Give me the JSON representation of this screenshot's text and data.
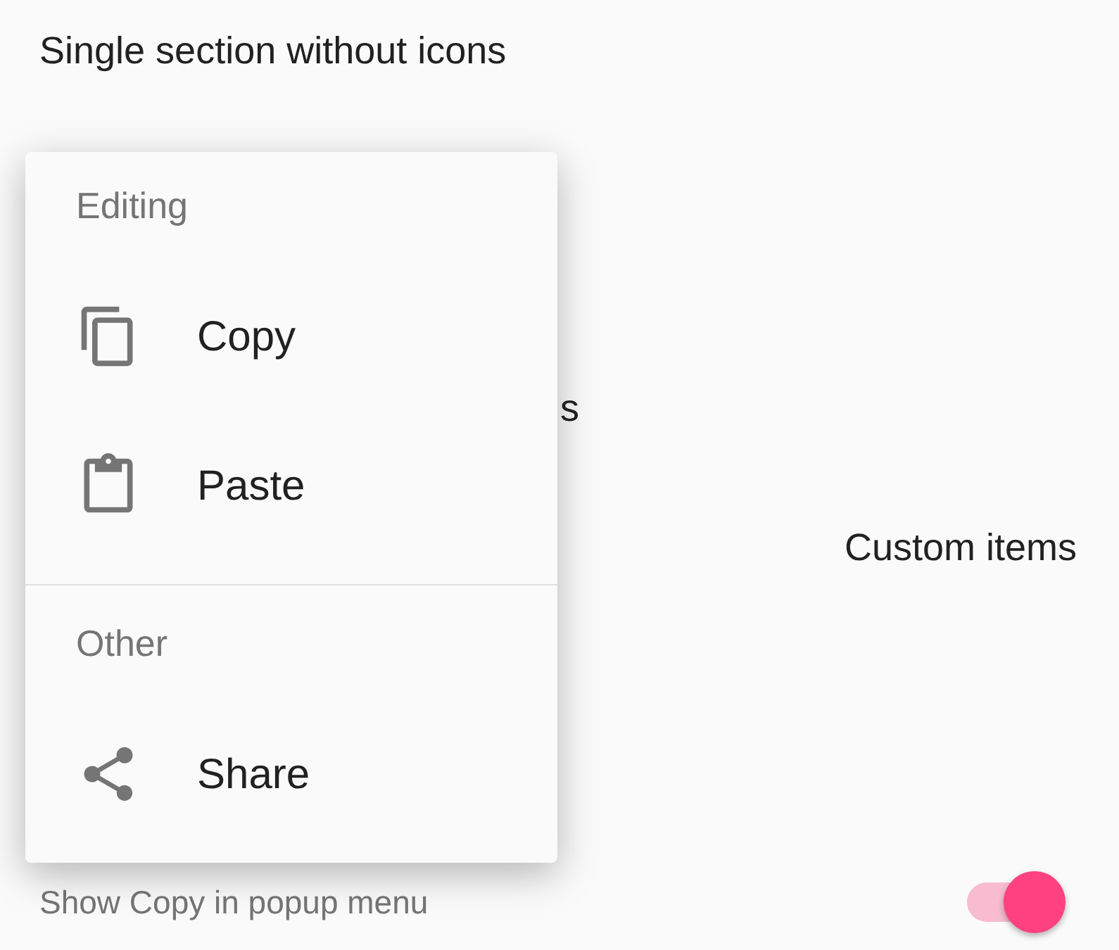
{
  "title": "Single section without icons",
  "background_texts": [
    {
      "text": "s"
    },
    {
      "text": "Custom items"
    }
  ],
  "switch_row": {
    "label": "Show Copy in popup menu",
    "on": true
  },
  "popup_menu": {
    "sections": [
      {
        "header": "Editing",
        "items": [
          {
            "label": "Copy",
            "kind": "copy"
          },
          {
            "label": "Paste",
            "kind": "paste"
          }
        ]
      },
      {
        "header": "Other",
        "items": [
          {
            "label": "Share",
            "kind": "share"
          }
        ]
      }
    ]
  }
}
